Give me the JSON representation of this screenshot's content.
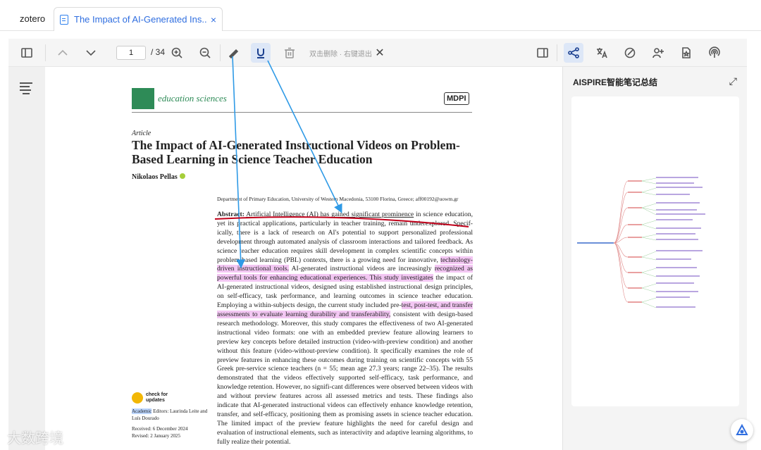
{
  "app": {
    "name": "zotero"
  },
  "tab": {
    "title": "The Impact of AI-Generated Ins...",
    "close": "×"
  },
  "toolbar": {
    "page_value": "1",
    "page_total": "/ 34",
    "hint": "双击删除 · 右键退出",
    "close": "✕"
  },
  "side_panel": {
    "title": "AISPIRE智能笔记总结",
    "expand": "⤢"
  },
  "document": {
    "journal": "education sciences",
    "publisher": "MDPI",
    "article_label": "Article",
    "title": "The Impact of AI-Generated Instructional Videos on Problem-Based Learning in Science Teacher Education",
    "author": "Nikolaos Pellas",
    "affiliation": "Department of Primary Education, University of Western Macedonia, 53100 Florina, Greece; aff00192@uowm.gr",
    "abstract_label": "Abstract:",
    "abstract_p1": "Artificial Intelligence (AI) has gained significant prominence",
    "abstract_p2": " in science education, yet its practical applications, particularly in teacher training, remain underexplored. Specif-ically, there is a lack of research on AI's potential to support personalized professional development through automated analysis of classroom interactions and tailored feedback. As science teacher education requires skill development in complex scientific concepts within problem-based learning (PBL) contexts, there is a growing need for innovative, ",
    "abstract_hl1": "technology-driven instructional tools.",
    "abstract_p3": " AI-generated instructional videos are increasingly ",
    "abstract_hl2": "recognized as powerful tools for enhancing educational experiences. This study investigates",
    "abstract_p4": " the impact of AI-generated instructional videos, designed using established instructional design principles, on self-efficacy, task performance, and learning outcomes in science teacher education. Employing a within-subjects design, the current study included pre-",
    "abstract_hl3": "test, post-test, and transfer assessments to evaluate learning durability and transferability,",
    "abstract_p5": " consistent with design-based research methodology. Moreover, this study compares the effectiveness of two AI-generated instructional video formats: one with an embedded preview feature allowing learners to preview key concepts before detailed instruction (video-with-preview condition) and another without this feature (video-without-preview condition). It specifically examines the role of preview features in enhancing these outcomes during training on scientific concepts with 55 Greek pre-service science teachers (n = 55; mean age 27.3 years; range 22–35). The results demonstrated that the videos effectively supported self-efficacy, task performance, and knowledge retention. However, no signifi-cant differences were observed between videos with and without preview features across all assessed metrics and tests. These findings also indicate that AI-generated instructional videos can effectively enhance knowledge retention, transfer, and self-efficacy, positioning them as promising assets in science teacher education. The limited impact of the preview feature highlights the need for careful design and evaluation of instructional elements, such as interactivity and adaptive learning algorithms, to fully realize their potential.",
    "check_label": "check for updates",
    "editors_academic": "Academic",
    "editors_rest": " Editors: Laurinda Leite and Luís Dourado",
    "received": "Received: 6 December 2024",
    "revised": "Revised: 2 January 2025"
  },
  "watermark": "大数跨境",
  "colors": {
    "accent": "#2f6ee0",
    "highlight": "#f3c7f3",
    "arrow": "#2f9ae6",
    "journal_green": "#2e8b57"
  }
}
